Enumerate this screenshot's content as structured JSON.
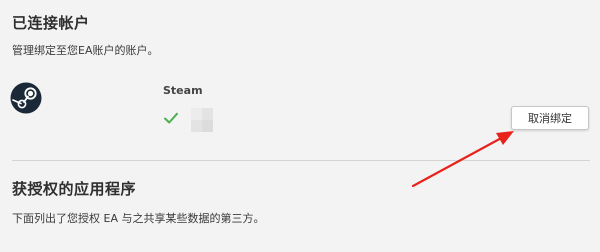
{
  "connected_accounts": {
    "title": "已连接帐户",
    "description": "管理绑定至您EA账户的账户。",
    "account": {
      "name": "Steam",
      "icon": "steam-icon",
      "status_icon": "check-icon",
      "status_color": "#4caf50"
    },
    "unlink_label": "取消绑定"
  },
  "authorized_apps": {
    "title": "获授权的应用程序",
    "description": "下面列出了您授权 EA 与之共享某些数据的第三方。"
  },
  "annotation": {
    "arrow_color": "#e8231b"
  }
}
